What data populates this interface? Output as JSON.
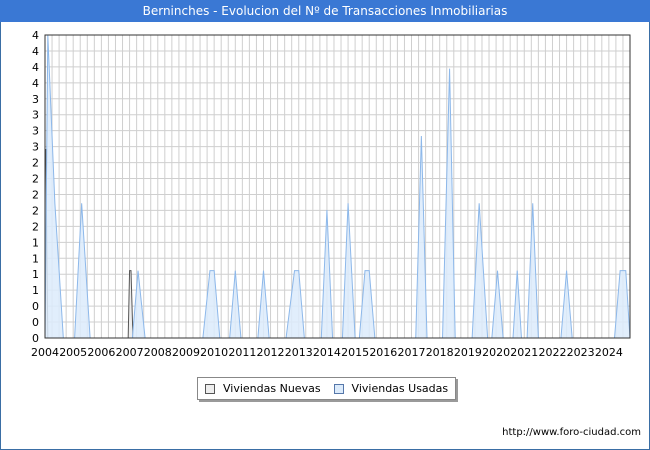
{
  "title": "Berninches - Evolucion del Nº de Transacciones Inmobiliarias",
  "footer_url": "http://www.foro-ciudad.com",
  "colors": {
    "title_bg": "#3a78d4",
    "nuevas_fill": "#eeeeee",
    "nuevas_stroke": "#555555",
    "usadas_fill": "#dcebfb",
    "usadas_stroke": "#8db8ea",
    "grid": "#cfcfcf"
  },
  "chart_data": {
    "type": "area",
    "title": "Berninches - Evolucion del Nº de Transacciones Inmobiliarias",
    "xlabel": "",
    "ylabel": "",
    "x_range": [
      2004.0,
      2024.75
    ],
    "ylim": [
      0,
      4.5
    ],
    "ytick_labels": [
      "0",
      "0",
      "0",
      "1",
      "1",
      "1",
      "1",
      "2",
      "2",
      "2",
      "2",
      "2",
      "3",
      "3",
      "3",
      "3",
      "4",
      "4",
      "4",
      "4"
    ],
    "xtick_labels": [
      "2004",
      "2005",
      "2006",
      "2007",
      "2008",
      "2009",
      "2010",
      "2011",
      "2012",
      "2013",
      "2014",
      "2015",
      "2016",
      "2017",
      "2018",
      "2019",
      "2020",
      "2021",
      "2022",
      "2023",
      "2024"
    ],
    "grid": true,
    "legend_position": "bottom-center",
    "series": [
      {
        "name": "Viviendas Nuevas",
        "points": [
          [
            2004.0,
            2.8
          ],
          [
            2004.03,
            2.8
          ],
          [
            2004.1,
            0
          ],
          [
            2006.95,
            0
          ],
          [
            2007.0,
            1.0
          ],
          [
            2007.05,
            1.0
          ],
          [
            2007.12,
            0
          ],
          [
            2024.75,
            0
          ]
        ]
      },
      {
        "name": "Viviendas Usadas",
        "points": [
          [
            2004.0,
            0
          ],
          [
            2004.1,
            4.5
          ],
          [
            2004.35,
            2.0
          ],
          [
            2004.65,
            0
          ],
          [
            2005.05,
            0
          ],
          [
            2005.3,
            2.0
          ],
          [
            2005.6,
            0
          ],
          [
            2007.1,
            0
          ],
          [
            2007.3,
            1.0
          ],
          [
            2007.55,
            0
          ],
          [
            2009.6,
            0
          ],
          [
            2009.85,
            1.0
          ],
          [
            2010.0,
            1.0
          ],
          [
            2010.2,
            0
          ],
          [
            2010.55,
            0
          ],
          [
            2010.75,
            1.0
          ],
          [
            2010.95,
            0
          ],
          [
            2011.55,
            0
          ],
          [
            2011.75,
            1.0
          ],
          [
            2011.95,
            0
          ],
          [
            2012.55,
            0
          ],
          [
            2012.85,
            1.0
          ],
          [
            2013.0,
            1.0
          ],
          [
            2013.2,
            0
          ],
          [
            2013.8,
            0
          ],
          [
            2014.0,
            1.9
          ],
          [
            2014.2,
            0
          ],
          [
            2014.55,
            0
          ],
          [
            2014.75,
            2.0
          ],
          [
            2015.0,
            0
          ],
          [
            2015.15,
            0
          ],
          [
            2015.35,
            1.0
          ],
          [
            2015.5,
            1.0
          ],
          [
            2015.7,
            0
          ],
          [
            2017.15,
            0
          ],
          [
            2017.35,
            3.0
          ],
          [
            2017.55,
            0
          ],
          [
            2018.1,
            0
          ],
          [
            2018.35,
            4.0
          ],
          [
            2018.55,
            0
          ],
          [
            2019.15,
            0
          ],
          [
            2019.4,
            2.0
          ],
          [
            2019.7,
            0
          ],
          [
            2019.85,
            0
          ],
          [
            2020.05,
            1.0
          ],
          [
            2020.25,
            0
          ],
          [
            2020.6,
            0
          ],
          [
            2020.75,
            1.0
          ],
          [
            2020.9,
            0
          ],
          [
            2021.1,
            0
          ],
          [
            2021.3,
            2.0
          ],
          [
            2021.5,
            0
          ],
          [
            2022.3,
            0
          ],
          [
            2022.5,
            1.0
          ],
          [
            2022.7,
            0
          ],
          [
            2024.2,
            0
          ],
          [
            2024.4,
            1.0
          ],
          [
            2024.6,
            1.0
          ],
          [
            2024.75,
            0
          ]
        ]
      }
    ]
  },
  "legend": {
    "nuevas": "Viviendas Nuevas",
    "usadas": "Viviendas Usadas"
  }
}
